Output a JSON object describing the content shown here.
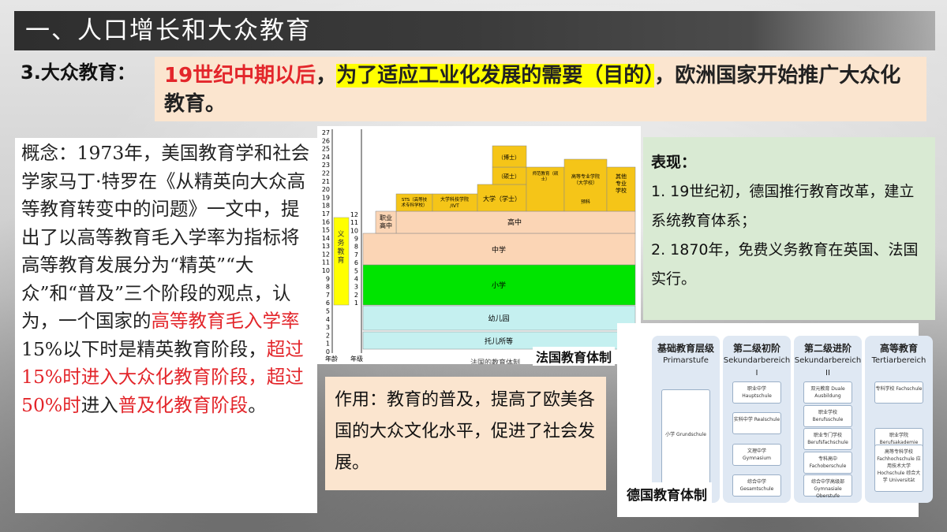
{
  "title": "一、人口增长和大众教育",
  "section_label": "3.大众教育：",
  "intro": {
    "part1": "19世纪中期以后",
    "part2": "，",
    "part3": "为了适应工业化发展的需要（目的）",
    "part4": "，欧洲国家开始推广大众化教育。"
  },
  "concept": {
    "t1": "概念：1973年，美国教育学和社会学家马丁·特罗在《从精英向大众高等教育转变中的问题》一文中，提出了以高等教育毛入学率为指标将高等教育发展分为“精英”“大众”和“普及”三个阶段的观点，认为，一个国家的",
    "t2": "高等教育毛入学率",
    "t3": "15%以下时是精英教育阶段，",
    "t4": "超过15%时进入大众化教育阶段，超过50%时",
    "t5": "进入",
    "t6": "普及化教育阶段",
    "t7": "。"
  },
  "french_chart": {
    "caption": "法国教育体制",
    "axis_age_label": "年龄",
    "axis_grade_label": "年级",
    "compulsory_label": "义务教育",
    "ages": [
      "27",
      "26",
      "25",
      "24",
      "23",
      "22",
      "21",
      "20",
      "19",
      "18",
      "17",
      "16",
      "15",
      "14",
      "13",
      "12",
      "11",
      "10",
      "9",
      "8",
      "7",
      "6",
      "5",
      "4",
      "3",
      "2",
      "1",
      "0"
    ],
    "grades": [
      "12",
      "11",
      "10",
      "9",
      "8",
      "7",
      "6",
      "5",
      "4",
      "3",
      "2",
      "1"
    ],
    "blocks": {
      "nursery": "托儿所等",
      "kindergarten": "幼儿园",
      "primary": "小学",
      "middle": "中学",
      "high": "高中",
      "vocational": "职业高中",
      "sts": "STS（高等技术专科学校）",
      "iut": "大学科技学院/IVT",
      "university": "大学（学士）",
      "masters": "（硕士）",
      "doctor": "（博士）",
      "teacher": "师范教育（硕士）",
      "grandes_ecoles": "高等专业学院（大学校）",
      "prep": "预科",
      "other": "其他专业学校",
      "footer": "法国的教育体制"
    },
    "colors": {
      "compulsory": "#ffff00",
      "higher": "#f5c518",
      "high": "#fbd5b5",
      "primary": "#00e400",
      "kindergarten": "#c5f0f0"
    }
  },
  "performance": {
    "head": "表现：",
    "p1": "1. 19世纪初，德国推行教育改革，建立系统教育体系；",
    "p2": "2. 1870年，免费义务教育在英国、法国实行。"
  },
  "effect": {
    "text": "作用：教育的普及，提高了欧美各国的大众文化水平，促进了社会发展。"
  },
  "german_chart": {
    "caption": "德国教育体制",
    "columns": [
      {
        "title": "基础教育层级",
        "sub": "Primarstufe",
        "items": [
          "小学 Grundschule"
        ]
      },
      {
        "title": "第二级初阶",
        "sub": "Sekundarbereich I",
        "items": [
          "职业中学 Hauptschule",
          "实科中学 Realschule",
          "文理中学 Gymnasium",
          "综合中学 Gesamtschule"
        ]
      },
      {
        "title": "第二级进阶",
        "sub": "Sekundarbereich II",
        "items": [
          "双元教育 Duale Ausbildung",
          "职业学校 Berufsschule",
          "职业专门学校 Berufsfachschule",
          "专科高中 Fachoberschule",
          "综合中学高级部 Gymnasiale Oberstufe"
        ]
      },
      {
        "title": "高等教育",
        "sub": "Tertiarbereich",
        "items": [
          "专科学校 Fachschule",
          "职业学院 Berufsakademie",
          "高等专科学校 Fachhochschule 应用技术大学 Hochschule 综合大学 Universität"
        ]
      }
    ]
  }
}
